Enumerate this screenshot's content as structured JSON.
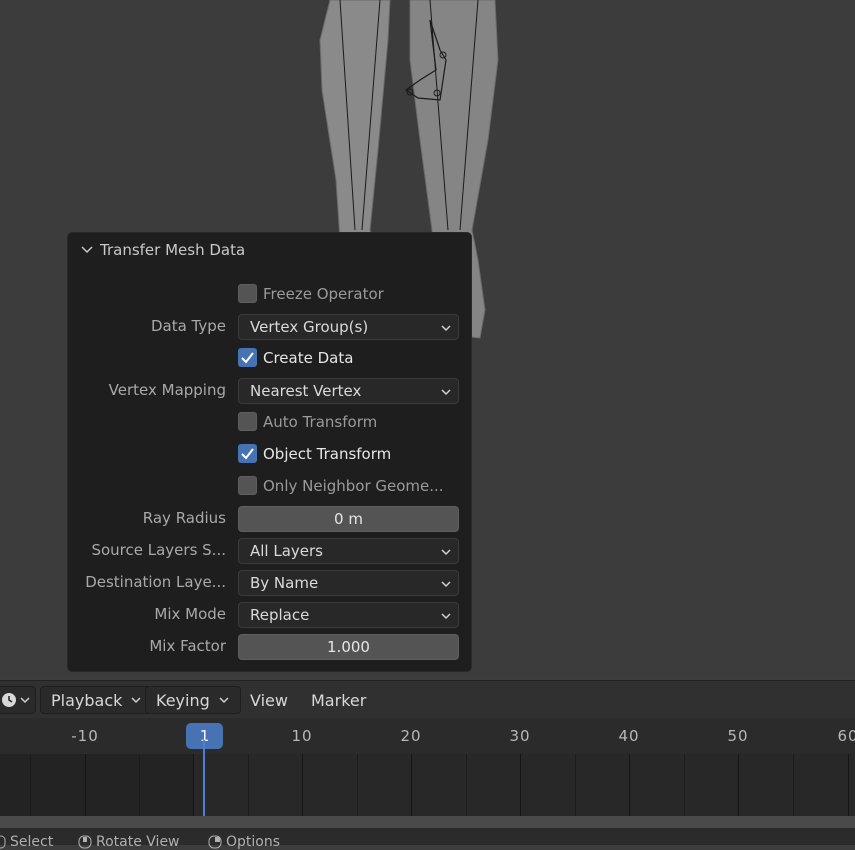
{
  "panel": {
    "title": "Transfer Mesh Data",
    "freeze_operator": {
      "label": "Freeze Operator",
      "checked": false
    },
    "data_type": {
      "label": "Data Type",
      "value": "Vertex Group(s)"
    },
    "create_data": {
      "label": "Create Data",
      "checked": true
    },
    "vertex_mapping": {
      "label": "Vertex Mapping",
      "value": "Nearest Vertex"
    },
    "auto_transform": {
      "label": "Auto Transform",
      "checked": false
    },
    "object_transform": {
      "label": "Object Transform",
      "checked": true
    },
    "only_neighbor": {
      "label": "Only Neighbor Geome...",
      "checked": false
    },
    "ray_radius": {
      "label": "Ray Radius",
      "value": "0 m"
    },
    "source_layers": {
      "label": "Source Layers S...",
      "value": "All Layers"
    },
    "destination_layers": {
      "label": "Destination Laye...",
      "value": "By Name"
    },
    "mix_mode": {
      "label": "Mix Mode",
      "value": "Replace"
    },
    "mix_factor": {
      "label": "Mix Factor",
      "value": "1.000"
    }
  },
  "timeline": {
    "menus": {
      "playback": "Playback",
      "keying": "Keying",
      "view": "View",
      "marker": "Marker"
    },
    "current_frame": "1",
    "ticks": [
      "-10",
      "10",
      "20",
      "30",
      "40",
      "50",
      "60"
    ]
  },
  "statusbar": {
    "select": "Select",
    "rotate_view": "Rotate View",
    "options": "Options"
  },
  "colors": {
    "accent": "#4772b3",
    "panel_bg": "#1e1e1e",
    "viewport_bg": "#3c3c3c"
  }
}
